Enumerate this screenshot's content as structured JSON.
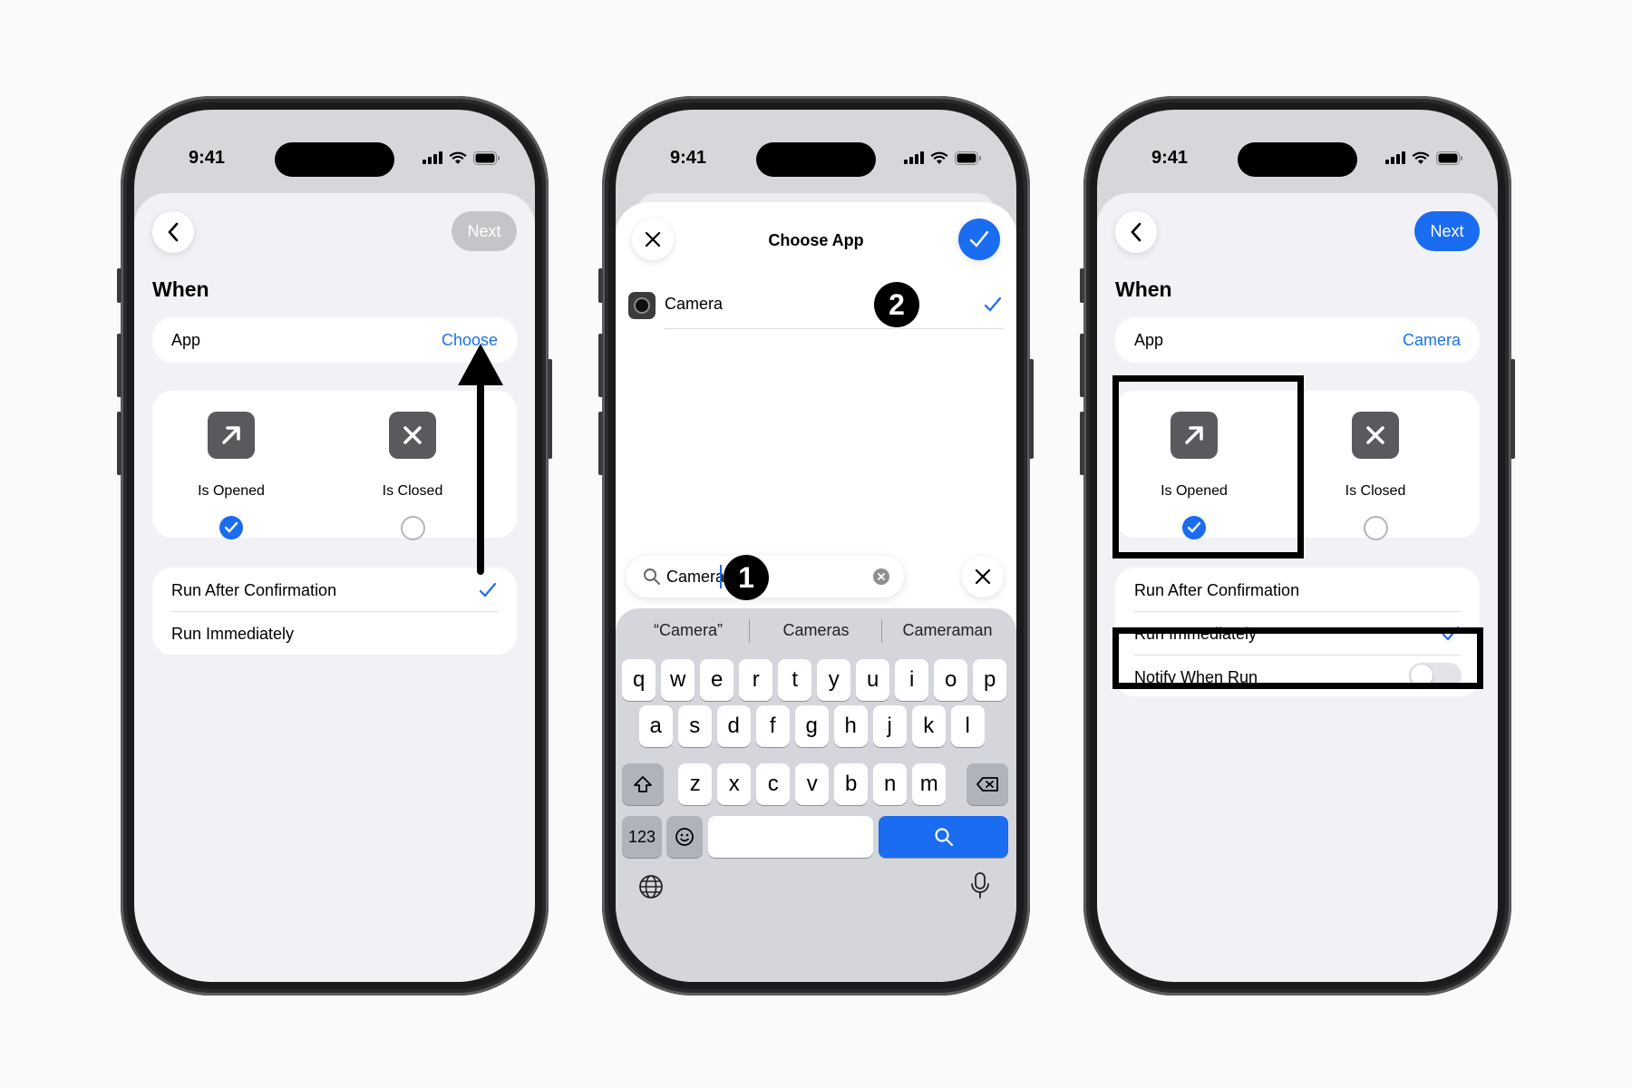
{
  "colors": {
    "accent": "#1a6cf0",
    "link": "#1a73e8",
    "next_disabled": "#c5c5c9",
    "background": "#fafafa"
  },
  "status": {
    "time": "9:41"
  },
  "phone1": {
    "next_label": "Next",
    "section_title": "When",
    "app_label": "App",
    "app_value": "Choose",
    "opened_label": "Is Opened",
    "closed_label": "Is Closed",
    "run_after_label": "Run After Confirmation",
    "run_immediately_label": "Run Immediately"
  },
  "phone2": {
    "title": "Choose App",
    "app_row_label": "Camera",
    "search_value": "Camera",
    "suggestions": [
      "“Camera”",
      "Cameras",
      "Cameraman"
    ],
    "keys_row1": [
      "q",
      "w",
      "e",
      "r",
      "t",
      "y",
      "u",
      "i",
      "o",
      "p"
    ],
    "keys_row2": [
      "a",
      "s",
      "d",
      "f",
      "g",
      "h",
      "j",
      "k",
      "l"
    ],
    "keys_row3": [
      "z",
      "x",
      "c",
      "v",
      "b",
      "n",
      "m"
    ],
    "key_123": "123",
    "step1": "1",
    "step2": "2"
  },
  "phone3": {
    "next_label": "Next",
    "section_title": "When",
    "app_label": "App",
    "app_value": "Camera",
    "opened_label": "Is Opened",
    "closed_label": "Is Closed",
    "run_after_label": "Run After Confirmation",
    "run_immediately_label": "Run Immediately",
    "notify_label": "Notify When Run",
    "notify_on": false
  }
}
